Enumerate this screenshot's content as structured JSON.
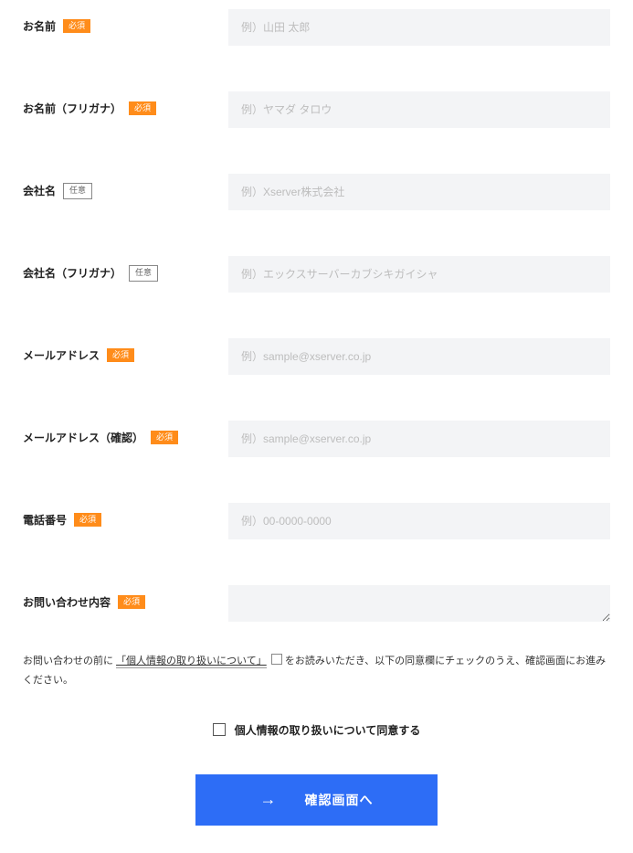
{
  "fields": {
    "name": {
      "label": "お名前",
      "badge": "必須",
      "badge_type": "required",
      "placeholder": "例）山田 太郎"
    },
    "name_kana": {
      "label": "お名前（フリガナ）",
      "badge": "必須",
      "badge_type": "required",
      "placeholder": "例）ヤマダ タロウ"
    },
    "company": {
      "label": "会社名",
      "badge": "任意",
      "badge_type": "optional",
      "placeholder": "例）Xserver株式会社"
    },
    "company_kana": {
      "label": "会社名（フリガナ）",
      "badge": "任意",
      "badge_type": "optional",
      "placeholder": "例）エックスサーバーカブシキガイシャ"
    },
    "email": {
      "label": "メールアドレス",
      "badge": "必須",
      "badge_type": "required",
      "placeholder": "例）sample@xserver.co.jp"
    },
    "email_confirm": {
      "label": "メールアドレス（確認）",
      "badge": "必須",
      "badge_type": "required",
      "placeholder": "例）sample@xserver.co.jp"
    },
    "phone": {
      "label": "電話番号",
      "badge": "必須",
      "badge_type": "required",
      "placeholder": "例）00-0000-0000"
    },
    "inquiry": {
      "label": "お問い合わせ内容",
      "badge": "必須",
      "badge_type": "required",
      "placeholder": ""
    }
  },
  "notice": {
    "prefix": "お問い合わせの前に",
    "link": "「個人情報の取り扱いについて」",
    "suffix": "をお読みいただき、以下の同意欄にチェックのうえ、確認画面にお進みください。"
  },
  "consent": {
    "label": "個人情報の取り扱いについて同意する"
  },
  "submit": {
    "label": "確認画面へ"
  }
}
